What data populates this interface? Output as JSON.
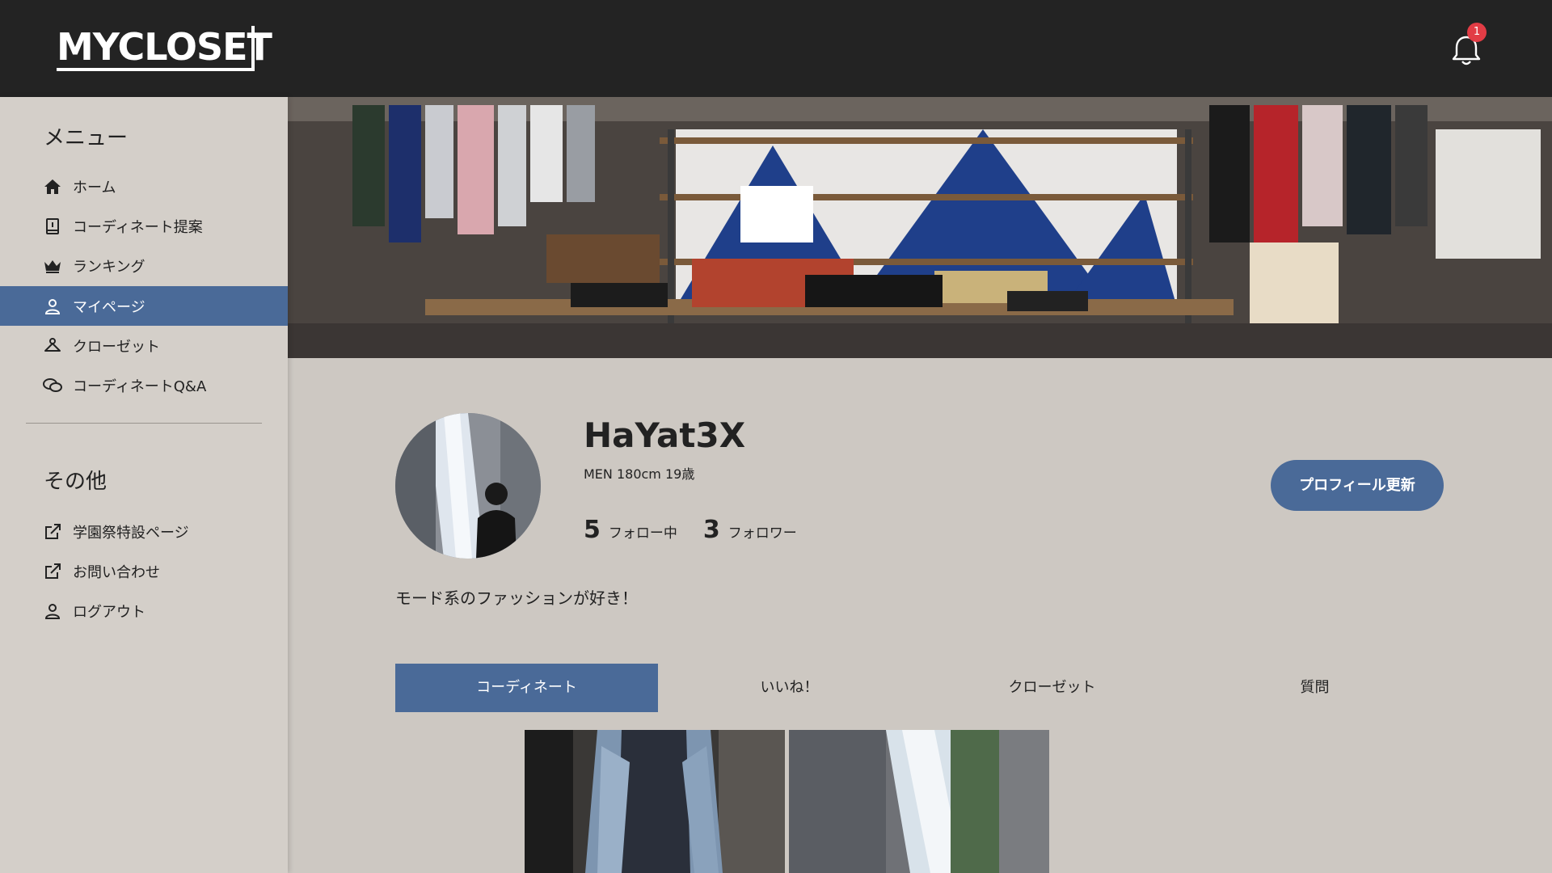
{
  "header": {
    "logo_text": "MYCLOSET",
    "notification_count": "1"
  },
  "sidebar": {
    "menu_heading": "メニュー",
    "menu_items": [
      {
        "label": "ホーム",
        "icon": "home-icon"
      },
      {
        "label": "コーディネート提案",
        "icon": "book-icon"
      },
      {
        "label": "ランキング",
        "icon": "crown-icon"
      },
      {
        "label": "マイページ",
        "icon": "user-icon"
      },
      {
        "label": "クローゼット",
        "icon": "hanger-icon"
      },
      {
        "label": "コーディネートQ&A",
        "icon": "chat-icon"
      }
    ],
    "other_heading": "その他",
    "other_items": [
      {
        "label": "学園祭特設ページ",
        "icon": "external-link-icon"
      },
      {
        "label": "お問い合わせ",
        "icon": "external-link-icon"
      },
      {
        "label": "ログアウト",
        "icon": "user-icon"
      }
    ],
    "active_item": "マイページ"
  },
  "profile": {
    "username": "HaYat3X",
    "subinfo": "MEN 180cm 19歳",
    "following_count": "5",
    "following_label": "フォロー中",
    "followers_count": "3",
    "followers_label": "フォロワー",
    "update_button": "プロフィール更新",
    "bio": "モード系のファッションが好き！"
  },
  "tabs": [
    {
      "label": "コーディネート",
      "active": true
    },
    {
      "label": "いいね！",
      "active": false
    },
    {
      "label": "クローゼット",
      "active": false
    },
    {
      "label": "質問",
      "active": false
    }
  ],
  "colors": {
    "header_bg": "#232323",
    "accent": "#4a6a98",
    "page_bg": "#cdc8c2",
    "sidebar_bg": "#d4cfc9",
    "badge": "#e23c45"
  }
}
